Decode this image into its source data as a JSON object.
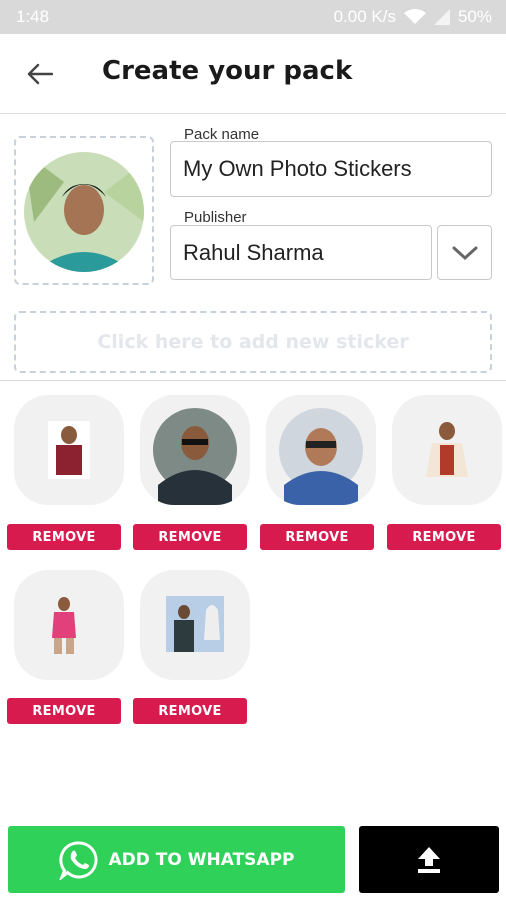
{
  "status_bar": {
    "time": "1:48",
    "net_speed": "0.00 K/s",
    "battery": "50%"
  },
  "header": {
    "title": "Create your pack"
  },
  "form": {
    "pack_name_label": "Pack name",
    "pack_name_value": "My Own Photo Stickers",
    "publisher_label": "Publisher",
    "publisher_value": "Rahul Sharma"
  },
  "add_sticker": {
    "label": "Click here to add new sticker"
  },
  "stickers": [
    {
      "remove_label": "REMOVE"
    },
    {
      "remove_label": "REMOVE"
    },
    {
      "remove_label": "REMOVE"
    },
    {
      "remove_label": "REMOVE"
    },
    {
      "remove_label": "REMOVE"
    },
    {
      "remove_label": "REMOVE"
    }
  ],
  "footer": {
    "whatsapp_label": "ADD TO WHATSAPP"
  },
  "icons": {
    "back": "arrow-left-icon",
    "dropdown": "chevron-down-icon",
    "whatsapp": "whatsapp-icon",
    "upload": "upload-icon"
  },
  "colors": {
    "remove": "#d81b4f",
    "whatsapp": "#2fd158",
    "upload": "#000000"
  }
}
